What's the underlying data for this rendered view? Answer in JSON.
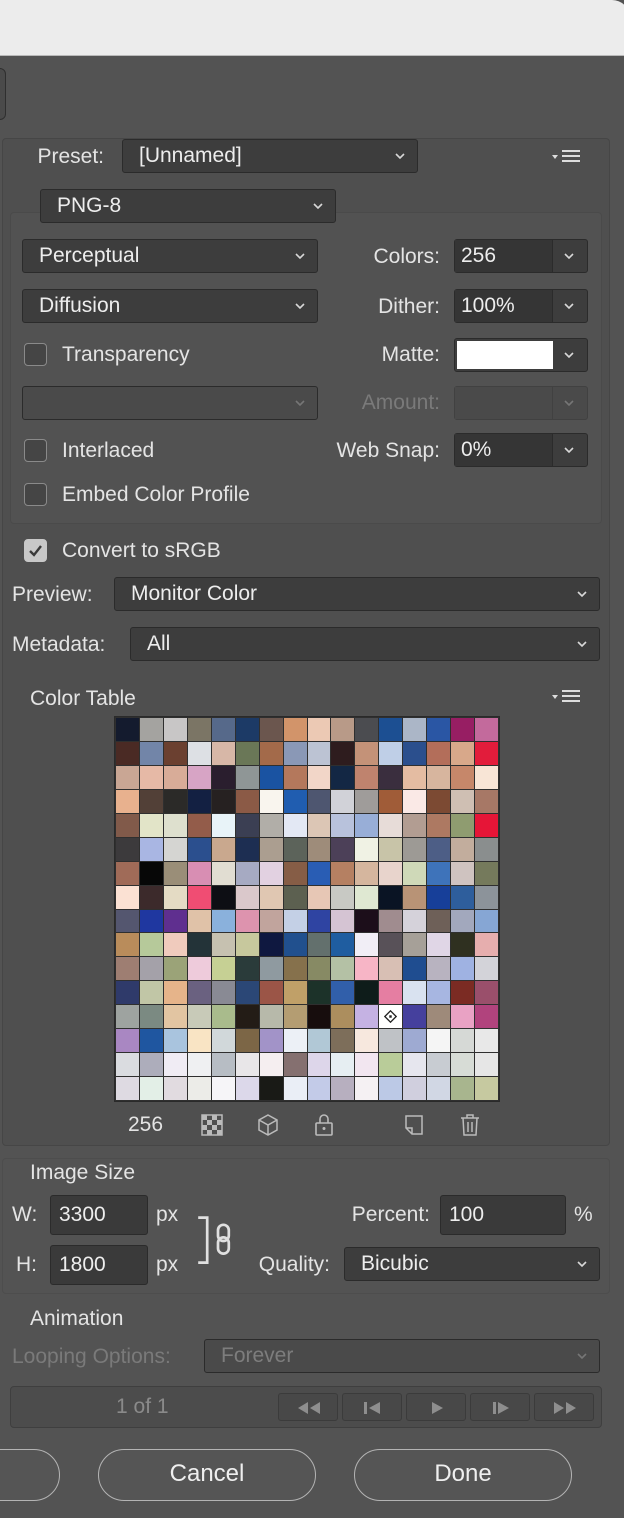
{
  "preset": {
    "label": "Preset:",
    "value": "[Unnamed]",
    "menu_icon": "panel-menu-icon"
  },
  "format": {
    "value": "PNG-8"
  },
  "reduction": {
    "value": "Perceptual"
  },
  "colors": {
    "label": "Colors:",
    "value": "256"
  },
  "dither_algo": {
    "value": "Diffusion"
  },
  "dither": {
    "label": "Dither:",
    "value": "100%"
  },
  "transparency": {
    "label": "Transparency",
    "checked": false
  },
  "matte": {
    "label": "Matte:",
    "color": "#ffffff"
  },
  "transparency_dither": {
    "value": ""
  },
  "amount": {
    "label": "Amount:",
    "value": ""
  },
  "interlaced": {
    "label": "Interlaced",
    "checked": false
  },
  "web_snap": {
    "label": "Web Snap:",
    "value": "0%"
  },
  "embed_profile": {
    "label": "Embed Color Profile",
    "checked": false
  },
  "convert_srgb": {
    "label": "Convert to sRGB",
    "checked": true
  },
  "preview": {
    "label": "Preview:",
    "value": "Monitor Color"
  },
  "metadata": {
    "label": "Metadata:",
    "value": "All"
  },
  "color_table": {
    "title": "Color Table",
    "count": "256",
    "tools": [
      "dither-pattern-icon",
      "web-cube-icon",
      "lock-icon",
      "new-color-icon",
      "trash-icon"
    ],
    "colors": [
      "#141b2e",
      "#a4a3a0",
      "#c8c6c6",
      "#7b7565",
      "#56698a",
      "#1c3a66",
      "#6b564e",
      "#d2946a",
      "#ecc9b4",
      "#b89a88",
      "#4b4c50",
      "#1c4f92",
      "#abb6c7",
      "#2a56a4",
      "#971e63",
      "#c36a9c",
      "#4a2a24",
      "#7285a8",
      "#6b4030",
      "#dde0e4",
      "#d7b7a7",
      "#6a7757",
      "#a36a4a",
      "#8a98b6",
      "#bcc3d3",
      "#2e1c1e",
      "#c49278",
      "#bfcfe7",
      "#2b4f8d",
      "#b36e5a",
      "#d8a88a",
      "#e21c3b",
      "#c9a694",
      "#e6b9a6",
      "#d8ac98",
      "#d7a4c5",
      "#2a1e2e",
      "#8f9696",
      "#1a53a2",
      "#b4785c",
      "#f2d6c8",
      "#132744",
      "#bf836e",
      "#3a2e3e",
      "#e4bca2",
      "#d7b59e",
      "#c6876a",
      "#f8e5d6",
      "#e8b18e",
      "#524037",
      "#2b2a28",
      "#132042",
      "#262121",
      "#8b5a46",
      "#f9f5ee",
      "#205db0",
      "#4e5670",
      "#d1d2d8",
      "#9f9c9a",
      "#a05c38",
      "#fae9e6",
      "#7c4a33",
      "#cfbfb3",
      "#a77866",
      "#815a4a",
      "#e2e4c8",
      "#dee0ce",
      "#935c4a",
      "#e8f3f8",
      "#3b3f53",
      "#b1aea8",
      "#e3e8f4",
      "#dcc6b5",
      "#b8c2dc",
      "#98aed7",
      "#e7dcd8",
      "#b29d92",
      "#ad7962",
      "#8f9c70",
      "#e61537",
      "#3c3a3c",
      "#a9b6e3",
      "#d5d5d2",
      "#2b4f8e",
      "#c9a88e",
      "#1d2e52",
      "#ab9e90",
      "#5c635a",
      "#9e8c7a",
      "#4c4058",
      "#f0f2e4",
      "#c8c4a8",
      "#9d9a95",
      "#4d5e86",
      "#c2ad9d",
      "#8a8e8e",
      "#a06b58",
      "#070707",
      "#9a8e78",
      "#d88eb3",
      "#e1ddd2",
      "#a6aac2",
      "#e2d1e1",
      "#865d46",
      "#295db4",
      "#b58062",
      "#d5b69e",
      "#e8d4cc",
      "#cfd9b8",
      "#3e73ba",
      "#cfc3c0",
      "#757a5c",
      "#fbe1d3",
      "#3c2a2b",
      "#e4dbc4",
      "#f04d73",
      "#0d0e14",
      "#dac8cb",
      "#e0c7b2",
      "#5c6050",
      "#e7c7b5",
      "#c8c9c4",
      "#dfe8d2",
      "#0a1424",
      "#b89376",
      "#173f99",
      "#2e5e9c",
      "#8c939a",
      "#54566f",
      "#1f37a0",
      "#5f2f8f",
      "#e0c2a8",
      "#8ab1dc",
      "#dd93ae",
      "#c1a49d",
      "#c4d0e6",
      "#2f44a2",
      "#d5c4d3",
      "#1c0e1a",
      "#a08c8f",
      "#d5d2da",
      "#6e6058",
      "#a2a8bd",
      "#86a6d4",
      "#b98c5b",
      "#b6c99a",
      "#f0cbbd",
      "#233338",
      "#c6c1b0",
      "#c7c89d",
      "#0f1840",
      "#21508e",
      "#63706d",
      "#1f5da0",
      "#f1eef6",
      "#585158",
      "#a6a098",
      "#e0d6e6",
      "#2f3020",
      "#e6aeae",
      "#9e7e72",
      "#a4a1a9",
      "#9ba378",
      "#eecbdb",
      "#c6d094",
      "#2a3b3a",
      "#8f9aa0",
      "#86714c",
      "#878a64",
      "#b4c1a5",
      "#f7b5c6",
      "#d8bfb4",
      "#1f4d90",
      "#b8b3c0",
      "#9fb2e2",
      "#d3d3d9",
      "#2f3a6a",
      "#c1c6a6",
      "#e6b48a",
      "#6a6180",
      "#898a94",
      "#2b4776",
      "#9b5547",
      "#c0a068",
      "#1c3229",
      "#315faa",
      "#0e1c1a",
      "#e57ea2",
      "#d9e2f0",
      "#a7b6e1",
      "#7b2b23",
      "#9a4f6b",
      "#9ea3a0",
      "#7b8a82",
      "#e2c5a2",
      "#c8cab8",
      "#a9bb8c",
      "#231c16",
      "#b7b9aa",
      "#b49d72",
      "#170d0d",
      "#ac8e5e",
      "#c5b2e3",
      "#ffffff",
      "#45409d",
      "#9e8a7a",
      "#e9a2c4",
      "#b1437d",
      "#a987c2",
      "#1f56a0",
      "#a9c4de",
      "#f9e4c4",
      "#d1d8da",
      "#7c6646",
      "#a293c8",
      "#ecf0f6",
      "#b1c8d6",
      "#7d6e5a",
      "#f7e8de",
      "#bfc2c6",
      "#9eaad2",
      "#f5f5f5",
      "#d6d9d6",
      "#e8e8e8",
      "#dadce0",
      "#adadbb",
      "#f0ecf4",
      "#eff0f2",
      "#b7bdc4",
      "#e8e6e8",
      "#f5eef0",
      "#857070",
      "#ddd6ea",
      "#e6eef2",
      "#f2e6f0",
      "#b9cc99",
      "#e6e6ee",
      "#c8ccd2",
      "#d7dcd6",
      "#e6e6e6",
      "#dedae2",
      "#e3efe7",
      "#e1dbe0",
      "#ecece8",
      "#f6f5f8",
      "#dcd8ea",
      "#191a16",
      "#eaeef6",
      "#c3cbe8",
      "#b7afbf",
      "#f5f1f3",
      "#bcc9e6",
      "#d0cfde",
      "#d1d7e4",
      "#a8b58e",
      "#c6c9a0"
    ]
  },
  "image_size": {
    "title": "Image Size",
    "w_label": "W:",
    "w_value": "3300",
    "h_label": "H:",
    "h_value": "1800",
    "unit": "px",
    "percent_label": "Percent:",
    "percent_value": "100",
    "percent_unit": "%",
    "quality_label": "Quality:",
    "quality_value": "Bicubic"
  },
  "animation": {
    "title": "Animation",
    "looping_label": "Looping Options:",
    "looping_value": "Forever",
    "frame": "1 of 1"
  },
  "footer": {
    "cancel": "Cancel",
    "done": "Done"
  }
}
